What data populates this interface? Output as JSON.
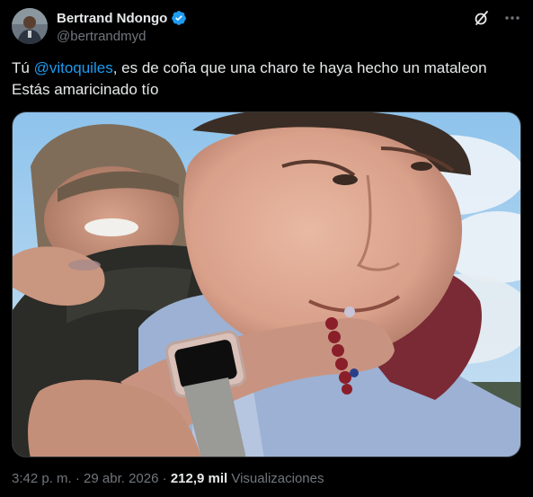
{
  "author": {
    "display_name": "Bertrand Ndongo",
    "handle": "@bertrandmyd",
    "verified": true,
    "verified_color": "#1d9bf0"
  },
  "header_actions": {
    "grok_icon": "grok-slash-icon",
    "more_icon": "more-dots-icon"
  },
  "tweet": {
    "text_prefix": "Tú ",
    "mention": "@vitoquiles",
    "text_line1_rest": ", es de coña que una charo te haya hecho un mataleon",
    "text_line2": "Estás amaricinado tío"
  },
  "media": {
    "type": "photo"
  },
  "meta": {
    "time": "3:42 p. m.",
    "separator": " · ",
    "date": "29 abr. 2026",
    "views_count": "212,9 mil",
    "views_label": " Visualizaciones"
  },
  "colors": {
    "background": "#000000",
    "text": "#e7e9ea",
    "secondary": "#71767b",
    "accent": "#1d9bf0",
    "border": "#2f3336"
  }
}
